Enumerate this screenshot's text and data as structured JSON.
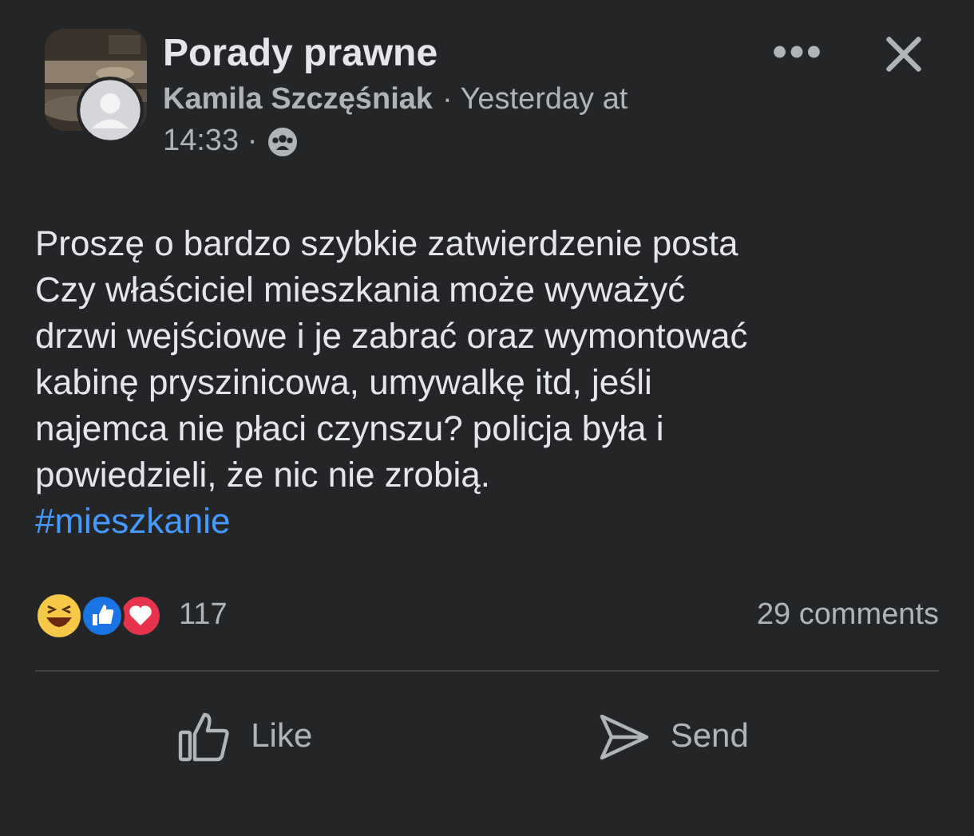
{
  "post": {
    "group_name": "Porady prawne",
    "author": "Kamila Szczęśniak",
    "time_prefix": "· Yesterday at",
    "time": "14:33 ·",
    "text": "Proszę o bardzo szybkie zatwierdzenie posta\nCzy właściciel mieszkania może wyważyć\ndrzwi wejściowe i je zabrać oraz wymontować\nkabinę pryszinicowa, umywalkę itd, jeśli\nnajemca nie płaci czynszu? policja była i\npowiedzieli, że nic nie zrobią.",
    "hashtag": "#mieszkanie"
  },
  "reactions": {
    "count": "117",
    "comments": "29 comments"
  },
  "actions": [
    {
      "kind": "like",
      "label": "Like"
    },
    {
      "kind": "send",
      "label": "Send"
    }
  ]
}
